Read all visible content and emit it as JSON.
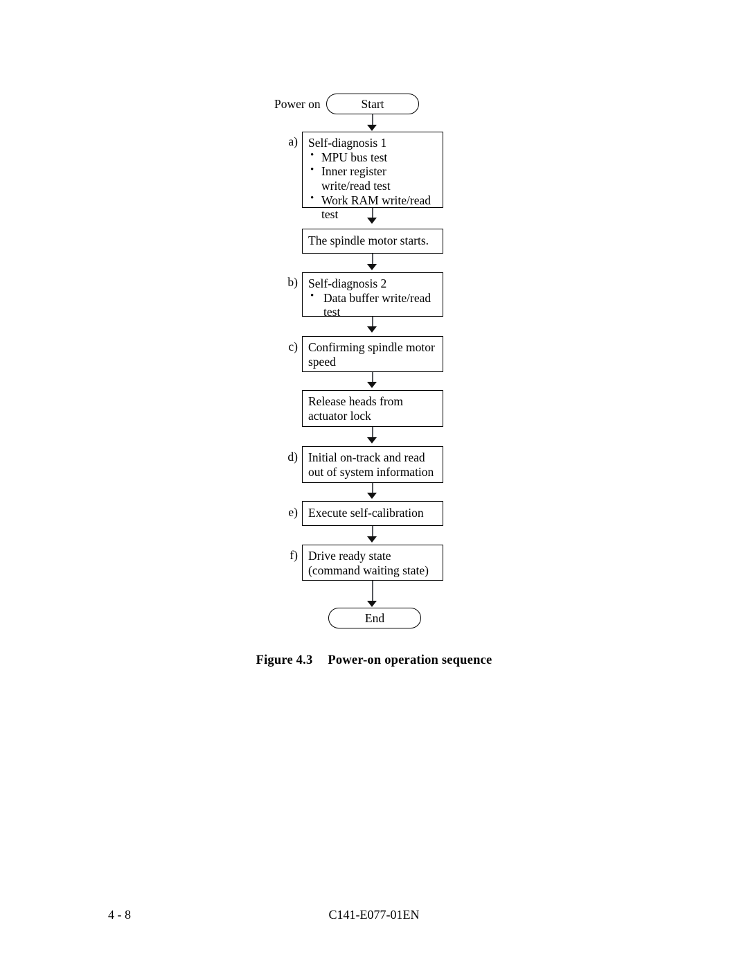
{
  "document": {
    "figure_caption_label": "Figure 4.3",
    "figure_caption_title": "Power-on operation sequence",
    "footer_page_number": "4 - 8",
    "footer_doc_code": "C141-E077-01EN"
  },
  "flowchart": {
    "entry_label": "Power on",
    "start_terminator": "Start",
    "end_terminator": "End",
    "steps": [
      {
        "letter": "a)",
        "title": "Self-diagnosis 1",
        "bullets": [
          "MPU bus test",
          "Inner register write/read test",
          "Work RAM write/read test"
        ]
      },
      {
        "letter": "",
        "title": "The spindle motor starts.",
        "bullets": []
      },
      {
        "letter": "b)",
        "title": "Self-diagnosis 2",
        "bullets": [
          "Data buffer write/read test"
        ]
      },
      {
        "letter": "c)",
        "title": "Confirming spindle motor speed",
        "bullets": []
      },
      {
        "letter": "",
        "title": "Release heads from actuator lock",
        "bullets": []
      },
      {
        "letter": "d)",
        "title": "Initial on-track and read out of system information",
        "bullets": []
      },
      {
        "letter": "e)",
        "title": "Execute self-calibration",
        "bullets": []
      },
      {
        "letter": "f)",
        "title": "Drive ready state (command waiting state)",
        "bullets": []
      }
    ]
  },
  "colors": {
    "ink": "#000000",
    "connector": "#55585c",
    "paper": "#ffffff"
  }
}
